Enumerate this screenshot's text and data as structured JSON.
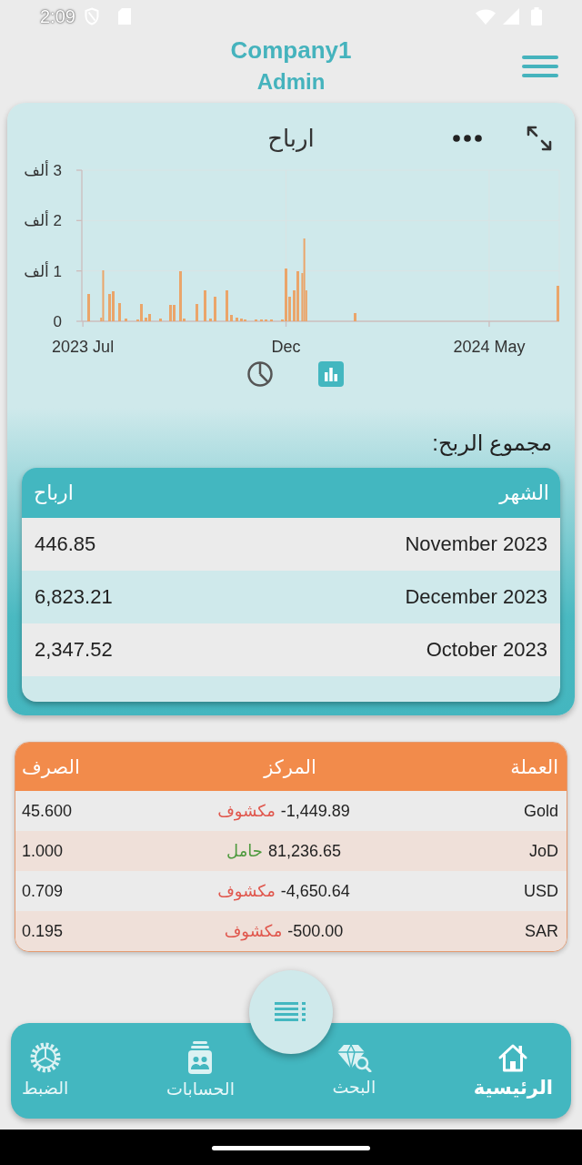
{
  "status_bar": {
    "time": "2:09"
  },
  "header": {
    "title": "Company1",
    "subtitle": "Admin"
  },
  "profit_card": {
    "chart_data": {
      "type": "bar",
      "title": "ارباح",
      "categories": [
        "2023 Jul",
        null,
        null,
        null,
        null,
        null,
        null,
        null,
        null,
        null,
        null,
        null,
        null,
        null,
        null,
        null,
        null,
        null,
        null,
        null,
        null,
        null,
        null,
        null,
        null,
        null,
        null,
        null,
        null,
        null,
        null,
        null,
        null,
        null,
        null,
        null,
        null,
        null,
        null,
        null,
        null,
        null,
        null,
        null,
        null,
        null,
        null,
        null,
        null,
        null,
        null,
        null,
        null,
        null,
        null,
        null,
        null,
        null,
        null,
        null,
        null,
        null,
        null,
        null,
        null,
        null,
        null,
        null,
        null,
        null,
        null,
        null,
        null,
        null,
        null,
        null,
        null,
        null,
        null,
        null,
        null,
        null,
        null,
        null,
        null,
        null,
        null,
        null,
        null,
        null,
        null,
        null,
        null,
        null,
        null,
        null,
        null,
        null,
        null,
        null,
        "Dec",
        null,
        null,
        null,
        null,
        null,
        null,
        null,
        null,
        null,
        null,
        null,
        null,
        null,
        null,
        null,
        null,
        null,
        null,
        null,
        null,
        null,
        null,
        null,
        null,
        null,
        null,
        null,
        null,
        null,
        null,
        null,
        null,
        null,
        null,
        null,
        null,
        null,
        null,
        null,
        null,
        null,
        null,
        null,
        null,
        null,
        null,
        null,
        null,
        null,
        null,
        null,
        null,
        null,
        null,
        null,
        null,
        null,
        null,
        null,
        null,
        null,
        null,
        null,
        null,
        null,
        null,
        null,
        null,
        null,
        null,
        null,
        null,
        null,
        null,
        null,
        null,
        null,
        null,
        null,
        null,
        null,
        null,
        null,
        null,
        null,
        null,
        null,
        null,
        null,
        null,
        null,
        null,
        null,
        null,
        null,
        null,
        null,
        null,
        null,
        "2024 May",
        null,
        null,
        null,
        null,
        null,
        null,
        null,
        null,
        null,
        null,
        null,
        null,
        null,
        null,
        null,
        null,
        null,
        null,
        null,
        null,
        null,
        null,
        null,
        null,
        null,
        null,
        null,
        null,
        null,
        null,
        null,
        null,
        null,
        null
      ],
      "values": [
        null,
        null,
        null,
        0.55,
        null,
        null,
        null,
        null,
        null,
        0.07,
        1.02,
        null,
        null,
        0.55,
        null,
        0.59,
        null,
        null,
        0.37,
        null,
        null,
        0.05,
        null,
        null,
        null,
        null,
        null,
        0.04,
        null,
        0.35,
        null,
        0.07,
        null,
        0.15,
        null,
        null,
        null,
        null,
        0.05,
        null,
        null,
        null,
        null,
        0.32,
        null,
        0.32,
        null,
        null,
        1.0,
        null,
        0.05,
        null,
        null,
        null,
        null,
        null,
        0.35,
        null,
        null,
        null,
        0.62,
        null,
        null,
        0.05,
        null,
        0.48,
        null,
        null,
        null,
        null,
        null,
        0.61,
        null,
        0.12,
        null,
        null,
        0.07,
        null,
        0.05,
        null,
        0.03,
        null,
        null,
        null,
        null,
        0.03,
        null,
        null,
        0.03,
        null,
        0.03,
        null,
        null,
        0.03,
        null,
        null,
        null,
        null,
        0.04,
        null,
        1.05,
        null,
        0.48,
        null,
        0.62,
        null,
        1.0,
        null,
        0.96,
        1.64,
        0.62,
        null,
        null,
        null,
        null,
        null,
        null,
        null,
        null,
        null,
        null,
        null,
        null,
        null,
        null,
        null,
        null,
        null,
        null,
        null,
        null,
        null,
        null,
        null,
        0.16,
        null,
        null,
        null,
        null,
        null,
        null,
        null,
        null,
        null,
        null,
        null,
        null,
        null,
        null,
        null,
        null,
        null,
        null,
        null,
        null,
        null,
        null,
        null,
        null,
        null,
        null,
        null,
        null,
        null,
        null,
        null,
        null,
        null,
        null,
        null,
        null,
        null,
        null,
        null,
        null,
        null,
        null,
        null,
        null,
        null,
        null,
        null,
        null,
        null,
        null,
        null,
        null,
        null,
        null,
        null,
        null,
        null,
        null,
        null,
        null,
        null,
        null,
        null,
        null,
        null,
        null,
        null,
        null,
        null,
        null,
        null,
        null,
        null,
        null,
        null,
        null,
        null,
        null,
        null,
        null,
        null,
        null,
        null,
        null,
        null,
        null,
        null,
        null,
        null,
        null,
        null,
        null,
        null,
        null,
        null,
        null,
        null,
        null,
        null,
        0.7
      ],
      "ylim": [
        0,
        3
      ],
      "yticks": [
        0,
        {
          "value": 1,
          "label": "1 ألف"
        },
        {
          "value": 2,
          "label": "2 ألف"
        },
        {
          "value": 3,
          "label": "3 ألف"
        }
      ]
    },
    "chart_toggles": [
      {
        "kind": "pie",
        "selected": false
      },
      {
        "kind": "bar",
        "selected": true
      }
    ],
    "total_label": "مجموع الربح:",
    "table": {
      "columns": [
        "الشهر",
        "ارباح"
      ],
      "rows": [
        [
          "November 2023",
          "446.85"
        ],
        [
          "December 2023",
          "6,823.21"
        ],
        [
          "October 2023",
          "2,347.52"
        ]
      ]
    }
  },
  "currency_table": {
    "columns": [
      "العملة",
      "المركز",
      "الصرف"
    ],
    "rows": [
      {
        "currency": "Gold",
        "amount": "-1,449.89",
        "status": "مكشوف",
        "color": "#e0574d",
        "rate": "45.600"
      },
      {
        "currency": "JoD",
        "amount": "81,236.65",
        "status": "حامل",
        "color": "#4e9a3e",
        "rate": "1.000"
      },
      {
        "currency": "USD",
        "amount": "-4,650.64",
        "status": "مكشوف",
        "color": "#e0574d",
        "rate": "0.709"
      },
      {
        "currency": "SAR",
        "amount": "-500.00",
        "status": "مكشوف",
        "color": "#e0574d",
        "rate": "0.195"
      }
    ]
  },
  "bottom_nav": {
    "items": [
      {
        "kind": "home",
        "label": "الرئيسية",
        "selected": true
      },
      {
        "kind": "search",
        "label": "البحث",
        "selected": false
      },
      {
        "kind": "accounts",
        "label": "الحسابات",
        "selected": false
      },
      {
        "kind": "settings",
        "label": "الضبط",
        "selected": false
      }
    ]
  }
}
